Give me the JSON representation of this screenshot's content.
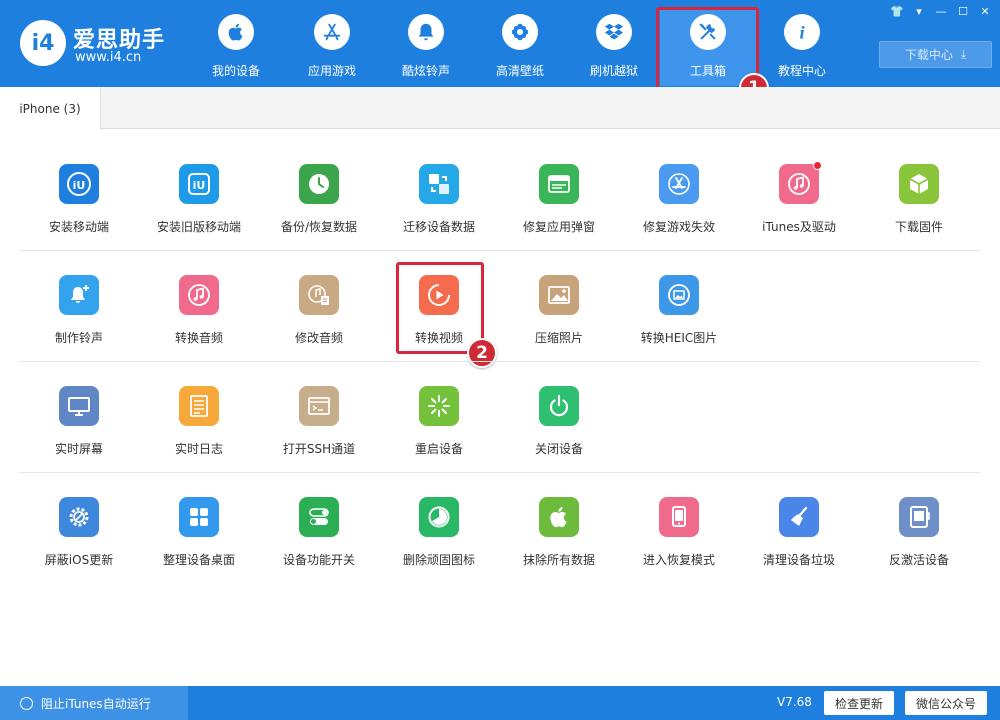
{
  "brand": {
    "name": "爱思助手",
    "url": "www.i4.cn",
    "logo_text": "i4"
  },
  "nav": [
    {
      "label": "我的设备",
      "icon": "apple-icon"
    },
    {
      "label": "应用游戏",
      "icon": "app-store-icon"
    },
    {
      "label": "酷炫铃声",
      "icon": "bell-icon"
    },
    {
      "label": "高清壁纸",
      "icon": "flower-icon"
    },
    {
      "label": "刷机越狱",
      "icon": "dropbox-icon"
    },
    {
      "label": "工具箱",
      "icon": "tools-icon",
      "active": true
    },
    {
      "label": "教程中心",
      "icon": "info-icon"
    }
  ],
  "download_center": {
    "label": "下载中心"
  },
  "annotations": {
    "badge1": "1",
    "badge2": "2"
  },
  "tabs": [
    {
      "label": "iPhone (3)"
    }
  ],
  "tools": [
    [
      {
        "label": "安装移动端",
        "icon": "i4-icon",
        "color": "#1e7fdf"
      },
      {
        "label": "安装旧版移动端",
        "icon": "i4-old-icon",
        "color": "#1e9ae8"
      },
      {
        "label": "备份/恢复数据",
        "icon": "backup-clock-icon",
        "color": "#3aa54a"
      },
      {
        "label": "迁移设备数据",
        "icon": "migrate-icon",
        "color": "#25a8e8"
      },
      {
        "label": "修复应用弹窗",
        "icon": "apple-id-icon",
        "color": "#3ab557"
      },
      {
        "label": "修复游戏失效",
        "icon": "app-store-icon",
        "color": "#4a9af0"
      },
      {
        "label": "iTunes及驱动",
        "icon": "itunes-icon",
        "color": "#f06a8c",
        "dot": true
      },
      {
        "label": "下载固件",
        "icon": "cube-icon",
        "color": "#8ac43a"
      }
    ],
    [
      {
        "label": "制作铃声",
        "icon": "bell-plus-icon",
        "color": "#33a3ee"
      },
      {
        "label": "转换音频",
        "icon": "music-note-icon",
        "color": "#f06a8c"
      },
      {
        "label": "修改音频",
        "icon": "music-file-icon",
        "color": "#c9a984"
      },
      {
        "label": "转换视频",
        "icon": "video-play-icon",
        "color": "#f56b4d"
      },
      {
        "label": "压缩照片",
        "icon": "photo-icon",
        "color": "#c7a37c"
      },
      {
        "label": "转换HEIC图片",
        "icon": "heic-icon",
        "color": "#3d98e8"
      }
    ],
    [
      {
        "label": "实时屏幕",
        "icon": "monitor-icon",
        "color": "#5f87c5"
      },
      {
        "label": "实时日志",
        "icon": "log-icon",
        "color": "#f6a83b"
      },
      {
        "label": "打开SSH通道",
        "icon": "ssh-icon",
        "color": "#c6ae8d"
      },
      {
        "label": "重启设备",
        "icon": "restart-icon",
        "color": "#74c13c"
      },
      {
        "label": "关闭设备",
        "icon": "power-icon",
        "color": "#2fbf71"
      }
    ],
    [
      {
        "label": "屏蔽iOS更新",
        "icon": "gear-block-icon",
        "color": "#3d88dc"
      },
      {
        "label": "整理设备桌面",
        "icon": "grid-icon",
        "color": "#3399ee"
      },
      {
        "label": "设备功能开关",
        "icon": "toggle-icon",
        "color": "#2cae55"
      },
      {
        "label": "删除顽固图标",
        "icon": "pie-icon",
        "color": "#28b866"
      },
      {
        "label": "抹除所有数据",
        "icon": "apple-erase-icon",
        "color": "#6cbb3c"
      },
      {
        "label": "进入恢复模式",
        "icon": "phone-icon",
        "color": "#f06a8c"
      },
      {
        "label": "清理设备垃圾",
        "icon": "broom-icon",
        "color": "#4a86e8"
      },
      {
        "label": "反激活设备",
        "icon": "deactivate-icon",
        "color": "#6f8fc9"
      }
    ]
  ],
  "footer": {
    "itunes_label": "阻止iTunes自动运行",
    "version": "V7.68",
    "check_update": "检查更新",
    "wechat": "微信公众号"
  },
  "colors": {
    "brand": "#1e7fdf",
    "highlight": "#d8263d"
  }
}
